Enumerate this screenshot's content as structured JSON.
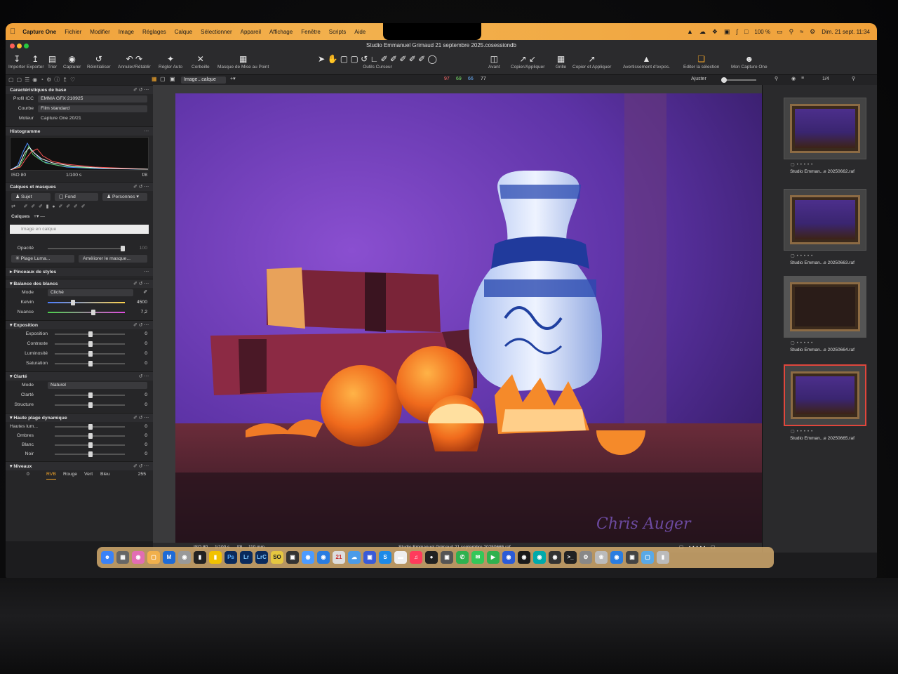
{
  "menubar": {
    "apple": "",
    "items": [
      "Capture One",
      "Fichier",
      "Modifier",
      "Image",
      "Réglages",
      "Calque",
      "Sélectionner",
      "Appareil",
      "Affichage",
      "Fenêtre",
      "Scripts",
      "Aide"
    ],
    "battery": "100 %",
    "clock": "Dim. 21 sept.  11:34"
  },
  "window": {
    "title": "Studio Emmanuel Grimaud 21 septembre 2025.cosessiondb"
  },
  "toolbar": {
    "importer": "Importer",
    "exporter": "Exporter",
    "trier": "Trier",
    "capturer": "Capturer",
    "reinit": "Réinitialiser",
    "annuler": "Annuler/Rétablir",
    "regler": "Régler Auto",
    "corbeille": "Corbeille",
    "masque": "Masque de Mise au Point",
    "outils": "Outils Curseur",
    "avant": "Avant",
    "copier": "Copier/Appliquer",
    "grille": "Grille",
    "copier2": "Copier et Appliquer",
    "avert": "Avertissement d'expos.",
    "editer": "Editer la sélection",
    "mon": "Mon Capture One"
  },
  "subbar": {
    "layer_select": "Image...calque",
    "r": "97",
    "g": "69",
    "b": "66",
    "l": "77",
    "fit": "Ajuster",
    "count": "1/4"
  },
  "left": {
    "base_title": "Caractéristiques de base",
    "profil_label": "Profil ICC",
    "profil": "EMMA GFX 210925",
    "courbe_label": "Courbe",
    "courbe": "Film standard",
    "moteur_label": "Moteur",
    "moteur": "Capture One 20/21",
    "histo_title": "Histogramme",
    "iso": "ISO 80",
    "speed": "1/100 s",
    "aperture": "f/8",
    "calques_title": "Calques et masques",
    "sujet": "Sujet",
    "fond": "Fond",
    "personnes": "Personnes",
    "calques_label": "Calques",
    "layer_name": "Image en calque",
    "opacite": "Opacité",
    "opacite_val": "100",
    "plage": "Plage Luma...",
    "ameliorer": "Améliorer le masque...",
    "pinceaux": "Pinceaux de styles",
    "bdb_title": "Balance des blancs",
    "mode_label": "Mode",
    "mode": "Cliché",
    "kelvin_label": "Kelvin",
    "kelvin": "4500",
    "nuance_label": "Nuance",
    "nuance": "7,2",
    "expo_title": "Exposition",
    "exposition": "Exposition",
    "contraste": "Contraste",
    "luminosite": "Luminosité",
    "saturation": "Saturation",
    "clarte_title": "Clarté",
    "clarte_mode": "Naturel",
    "clarte": "Clarté",
    "structure": "Structure",
    "hdr_title": "Haute plage dynamique",
    "hautes": "Hautes lum...",
    "ombres": "Ombres",
    "blanc": "Blanc",
    "noir": "Noir",
    "niveaux_title": "Niveaux",
    "niv_min": "0",
    "niv_max": "255",
    "rvb": "RVB",
    "rouge": "Rouge",
    "vert": "Vert",
    "bleu": "Bleu",
    "zero": "0"
  },
  "viewer": {
    "signature": "Chris Auger",
    "info_iso": "ISO 80",
    "info_speed": "1/100 s",
    "info_ap": "f/8",
    "info_focal": "110 mm",
    "filename": "Studio Emmanuel Grimaud 21 septembre 20250665.raf"
  },
  "thumbs": [
    {
      "caption": "Studio Emman...e 20250662.raf"
    },
    {
      "caption": "Studio Emman...e 20250663.raf"
    },
    {
      "caption": "Studio Emman...e 20250664.raf"
    },
    {
      "caption": "Studio Emman...e 20250665.raf"
    }
  ],
  "colors": {
    "menubar": "#f0a13a",
    "selected": "#e0463c",
    "accent_orange": "#f4a62a"
  }
}
